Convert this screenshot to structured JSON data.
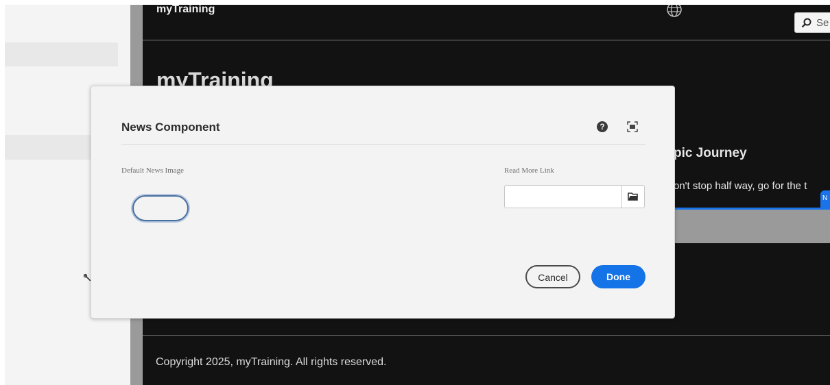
{
  "site": {
    "nav_title": "myTraining",
    "search_placeholder": "Se",
    "hero_title": "myTraining",
    "teaser_heading": "pic Journey",
    "teaser_text": "on't stop half way, go for the t",
    "blue_tab_label": "N",
    "footer": "Copyright 2025, myTraining. All rights reserved."
  },
  "dialog": {
    "title": "News Component",
    "image_label": "Default News Image",
    "link_label": "Read More Link",
    "link_value": "",
    "cancel_label": "Cancel",
    "done_label": "Done"
  },
  "colors": {
    "accent": "#1473e6",
    "site_bg": "#121212",
    "dialog_bg": "#f3f3f3"
  },
  "icons": {
    "wrench": "wrench-icon",
    "globe": "globe-icon",
    "search": "search-icon",
    "help": "help-icon",
    "fullscreen": "fullscreen-icon",
    "folder": "folder-icon"
  }
}
